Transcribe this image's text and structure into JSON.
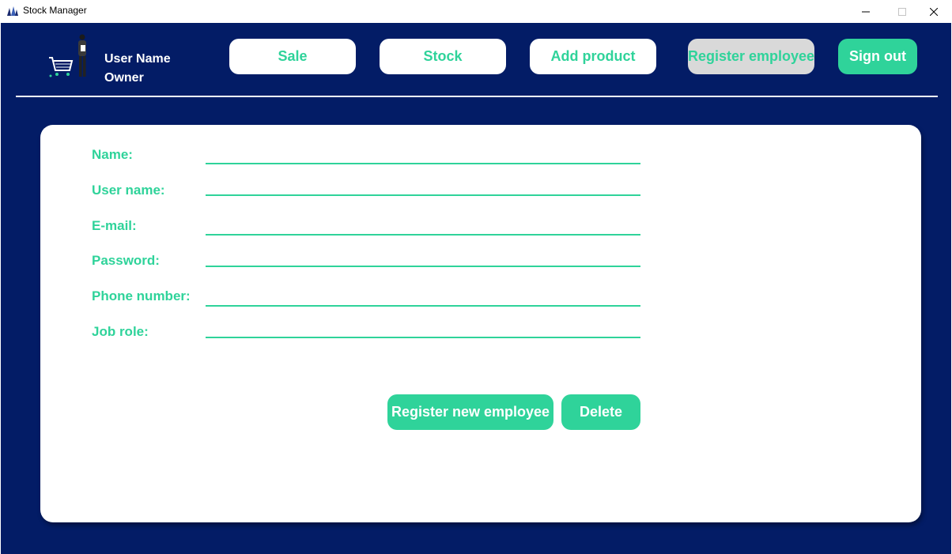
{
  "window": {
    "title": "Stock Manager",
    "controls": {
      "minimize": "—",
      "maximize": "☐",
      "close": "✕"
    }
  },
  "user": {
    "name": "User Name",
    "role": "Owner"
  },
  "nav": {
    "sale": "Sale",
    "stock": "Stock",
    "add_product": "Add product",
    "register_employee": "Register employee",
    "sign_out": "Sign out",
    "active": "register_employee"
  },
  "form": {
    "fields": [
      {
        "key": "name",
        "label": "Name:",
        "value": ""
      },
      {
        "key": "username",
        "label": "User name:",
        "value": ""
      },
      {
        "key": "email",
        "label": "E-mail:",
        "value": ""
      },
      {
        "key": "password",
        "label": "Password:",
        "value": ""
      },
      {
        "key": "phone",
        "label": "Phone number:",
        "value": ""
      },
      {
        "key": "job_role",
        "label": "Job role:",
        "value": ""
      }
    ],
    "register_button": "Register new employee",
    "delete_button": "Delete"
  },
  "colors": {
    "background": "#031c66",
    "accent": "#2fd39a",
    "card": "#ffffff",
    "active_nav": "#d9d9d9"
  },
  "icons": {
    "app": "stock-manager-logo-icon",
    "user_illustration": "shopping-cart-person-icon"
  }
}
